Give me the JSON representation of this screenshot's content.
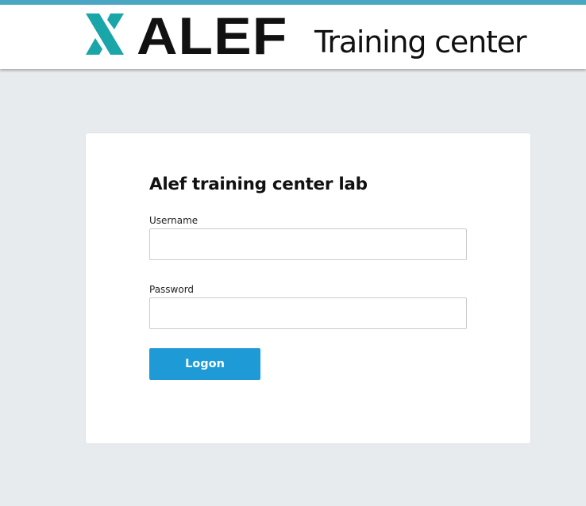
{
  "header": {
    "brand": "ALEF",
    "subtitle": "Training center",
    "logo_icon": "alef-x-logo-icon",
    "accent_color": "#4aa7c3",
    "logo_color": "#1aa6a8"
  },
  "login": {
    "title": "Alef training center lab",
    "username_label": "Username",
    "username_value": "",
    "password_label": "Password",
    "password_value": "",
    "submit_label": "Logon",
    "button_color": "#1e9bd7"
  }
}
